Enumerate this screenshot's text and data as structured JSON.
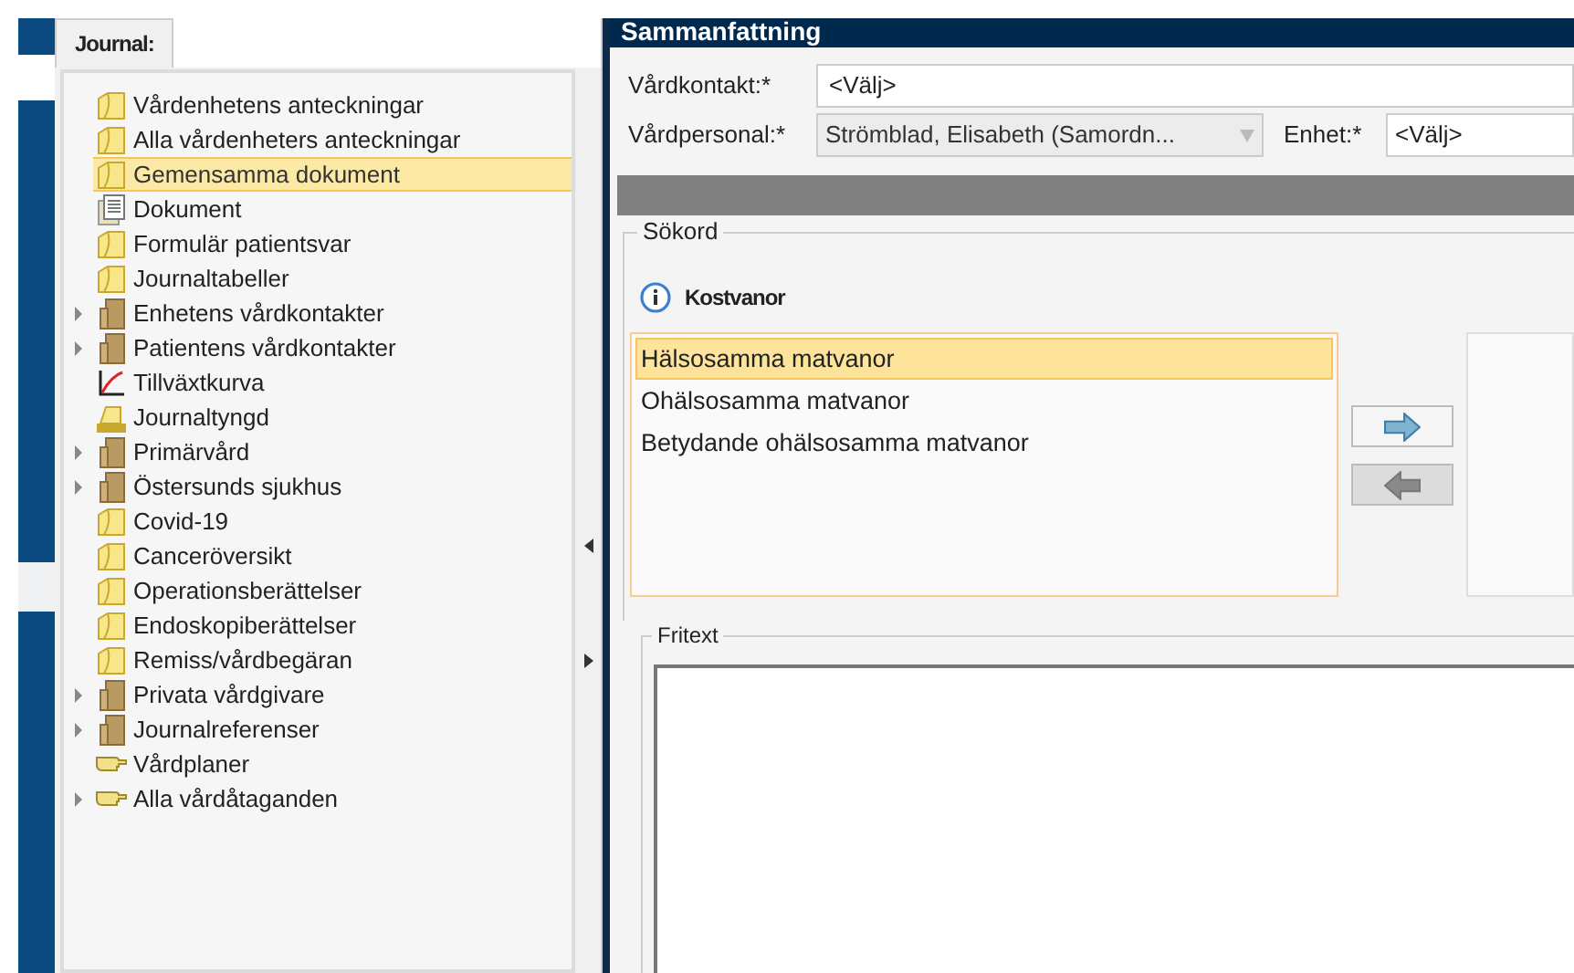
{
  "journal_panel": {
    "tab": {
      "label": "Journal:",
      "selected": true
    },
    "tree": [
      {
        "label": "Vårdenhetens anteckningar",
        "kind": "note",
        "expandable": false,
        "selected": false
      },
      {
        "label": "Alla vårdenheters anteckningar",
        "kind": "note",
        "expandable": false,
        "selected": false
      },
      {
        "label": "Gemensamma dokument",
        "kind": "note",
        "expandable": false,
        "selected": true
      },
      {
        "label": "Dokument",
        "kind": "document",
        "expandable": false,
        "selected": false
      },
      {
        "label": "Formulär patientsvar",
        "kind": "note",
        "expandable": false,
        "selected": false
      },
      {
        "label": "Journaltabeller",
        "kind": "note",
        "expandable": false,
        "selected": false
      },
      {
        "label": "Enhetens vårdkontakter",
        "kind": "folder",
        "expandable": true,
        "selected": false
      },
      {
        "label": "Patientens vårdkontakter",
        "kind": "folder",
        "expandable": true,
        "selected": false
      },
      {
        "label": "Tillväxtkurva",
        "kind": "chart",
        "expandable": false,
        "selected": false
      },
      {
        "label": "Journaltyngd",
        "kind": "stack",
        "expandable": false,
        "selected": false
      },
      {
        "label": "Primärvård",
        "kind": "folder",
        "expandable": true,
        "selected": false
      },
      {
        "label": "Östersunds sjukhus",
        "kind": "folder",
        "expandable": true,
        "selected": false
      },
      {
        "label": "Covid-19",
        "kind": "note",
        "expandable": false,
        "selected": false
      },
      {
        "label": "Canceröversikt",
        "kind": "note",
        "expandable": false,
        "selected": false
      },
      {
        "label": "Operationsberättelser",
        "kind": "note",
        "expandable": false,
        "selected": false
      },
      {
        "label": "Endoskopiberättelser",
        "kind": "note",
        "expandable": false,
        "selected": false
      },
      {
        "label": "Remiss/vårdbegäran",
        "kind": "note",
        "expandable": false,
        "selected": false
      },
      {
        "label": "Privata vårdgivare",
        "kind": "folder",
        "expandable": true,
        "selected": false
      },
      {
        "label": "Journalreferenser",
        "kind": "folder",
        "expandable": true,
        "selected": false
      },
      {
        "label": "Vårdplaner",
        "kind": "hand",
        "expandable": false,
        "selected": false
      },
      {
        "label": "Alla vårdåtaganden",
        "kind": "hand",
        "expandable": true,
        "selected": false
      }
    ]
  },
  "summary": {
    "title": "Sammanfattning",
    "vardkontakt": {
      "label": "Vårdkontakt:*",
      "value": "<Välj>"
    },
    "vardpersonal": {
      "label": "Vårdpersonal:*",
      "value": "Strömblad, Elisabeth (Samordn...",
      "disabled": true
    },
    "enhet": {
      "label": "Enhet:*",
      "value": "<Välj>"
    },
    "sokord": {
      "legend": "Sökord",
      "heading": "Kostvanor",
      "options": [
        {
          "label": "Hälsosamma matvanor",
          "selected": true
        },
        {
          "label": "Ohälsosamma matvanor",
          "selected": false
        },
        {
          "label": "Betydande ohälsosamma matvanor",
          "selected": false
        }
      ],
      "buttons": [
        {
          "kind": "forward",
          "disabled": false
        },
        {
          "kind": "back",
          "disabled": true
        }
      ]
    },
    "fritext": {
      "legend": "Fritext"
    }
  }
}
